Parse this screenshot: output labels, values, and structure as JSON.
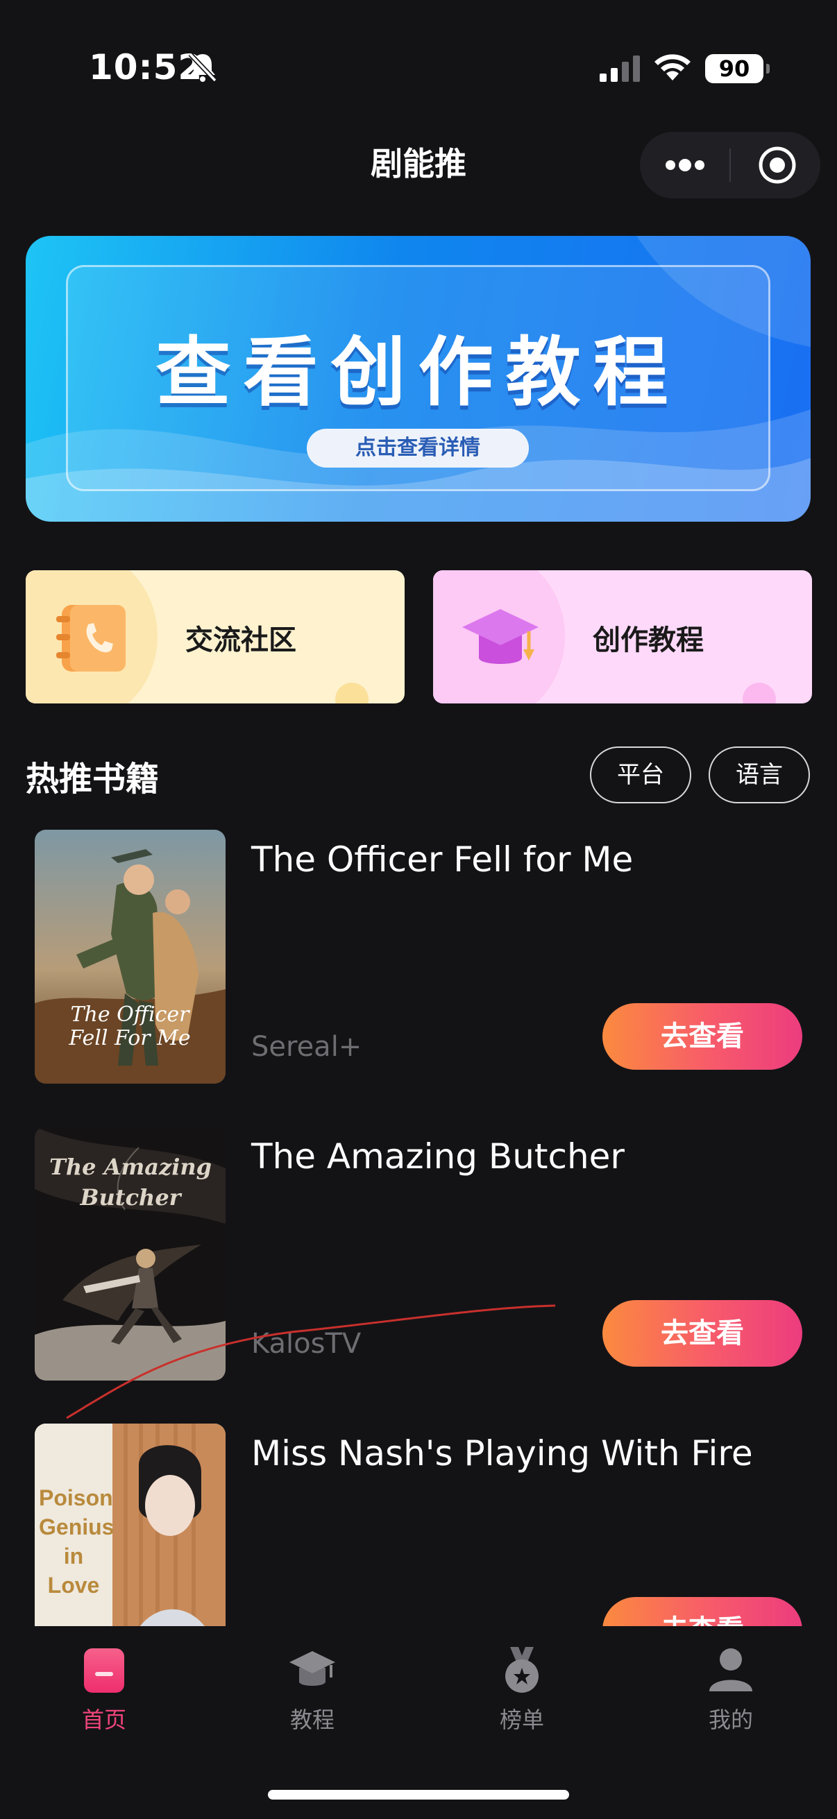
{
  "status_bar": {
    "time": "10:52",
    "battery": "90",
    "icons": [
      "bell-off-icon",
      "signal-icon",
      "wifi-icon",
      "battery-icon"
    ]
  },
  "nav": {
    "title": "剧能推",
    "icons": [
      "more-icon",
      "target-icon"
    ]
  },
  "banner": {
    "title": "查看创作教程",
    "cta": "点击查看详情"
  },
  "entries": [
    {
      "label": "交流社区",
      "icon": "contact-book-icon"
    },
    {
      "label": "创作教程",
      "icon": "graduation-cap-icon"
    }
  ],
  "section": {
    "title": "热推书籍",
    "filters": [
      "平台",
      "语言"
    ]
  },
  "books": [
    {
      "title": "The Officer Fell for Me",
      "platform": "Sereal+",
      "button": "去查看",
      "cover_text": "The Officer Fell For Me"
    },
    {
      "title": "The Amazing Butcher",
      "platform": "KalosTV",
      "button": "去查看",
      "cover_text": "The Amazing Butcher"
    },
    {
      "title": "Miss Nash's Playing With Fire",
      "platform": "",
      "button": "去查看",
      "cover_text": "Poison Genius in Love"
    }
  ],
  "tabs": [
    {
      "label": "首页",
      "icon": "home-icon",
      "active": true
    },
    {
      "label": "教程",
      "icon": "graduation-cap-icon",
      "active": false
    },
    {
      "label": "榜单",
      "icon": "medal-icon",
      "active": false
    },
    {
      "label": "我的",
      "icon": "user-icon",
      "active": false
    }
  ],
  "colors": {
    "background": "#131316",
    "accent": "#f0457a",
    "button_gradient_start": "#fb8a3f",
    "button_gradient_end": "#ec3c7e",
    "banner_blue": "#0f86ee"
  }
}
